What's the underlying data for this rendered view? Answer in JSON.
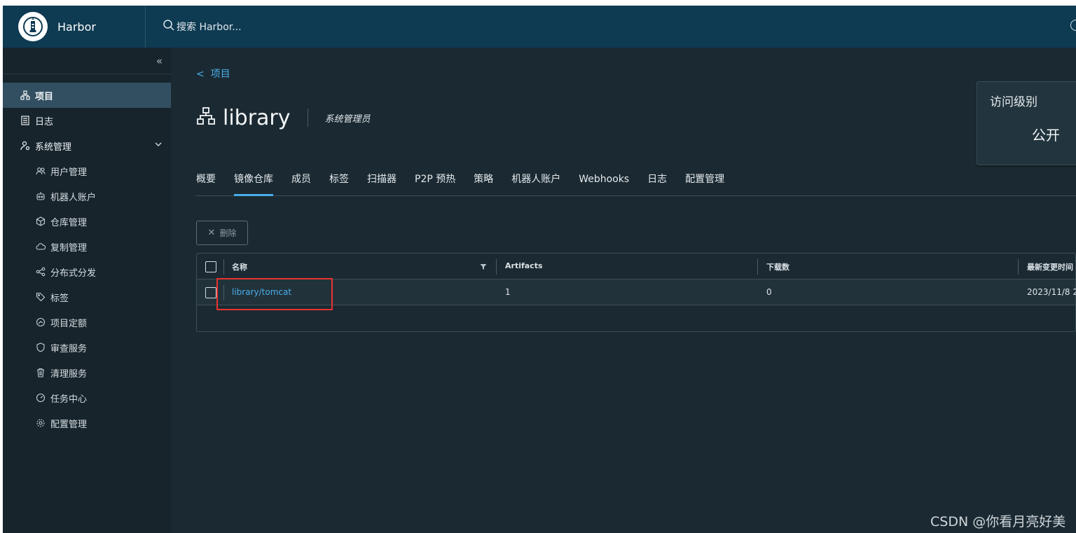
{
  "header": {
    "brand": "Harbor",
    "search_placeholder": "搜索 Harbor..."
  },
  "sidebar": {
    "items": [
      {
        "label": "项目",
        "icon": "project-icon"
      },
      {
        "label": "日志",
        "icon": "log-icon"
      },
      {
        "label": "系统管理",
        "icon": "admin-icon"
      }
    ],
    "sub_items": [
      {
        "label": "用户管理",
        "icon": "users-icon"
      },
      {
        "label": "机器人账户",
        "icon": "robot-icon"
      },
      {
        "label": "仓库管理",
        "icon": "box-icon"
      },
      {
        "label": "复制管理",
        "icon": "cloud-icon"
      },
      {
        "label": "分布式分发",
        "icon": "share-icon"
      },
      {
        "label": "标签",
        "icon": "tag-icon"
      },
      {
        "label": "项目定额",
        "icon": "quota-icon"
      },
      {
        "label": "审查服务",
        "icon": "shield-icon"
      },
      {
        "label": "清理服务",
        "icon": "trash-icon"
      },
      {
        "label": "任务中心",
        "icon": "dashboard-icon"
      },
      {
        "label": "配置管理",
        "icon": "gear-icon"
      }
    ]
  },
  "main": {
    "back_label": "项目",
    "project_name": "library",
    "role": "系统管理员",
    "access": {
      "label": "访问级别",
      "value": "公开"
    },
    "tabs": [
      "概要",
      "镜像仓库",
      "成员",
      "标签",
      "扫描器",
      "P2P 预热",
      "策略",
      "机器人账户",
      "Webhooks",
      "日志",
      "配置管理"
    ],
    "active_tab": "镜像仓库",
    "delete_label": "删除",
    "table": {
      "headers": [
        "名称",
        "Artifacts",
        "下载数",
        "最新变更时间"
      ],
      "rows": [
        {
          "name": "library/tomcat",
          "artifacts": "1",
          "downloads": "0",
          "updated": "2023/11/8 2"
        }
      ]
    }
  },
  "watermark": "CSDN @你看月亮好美",
  "colors": {
    "accent": "#49aeea",
    "header_bg": "#0e3a52",
    "highlight": "#e8332f"
  }
}
